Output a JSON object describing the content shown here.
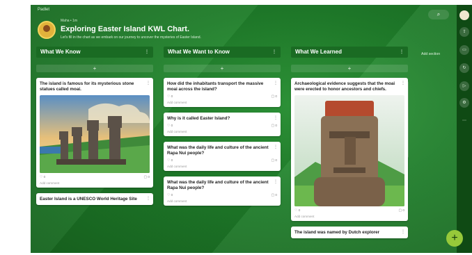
{
  "app": {
    "name": "Padlet"
  },
  "header": {
    "author": "Maha • 1m",
    "title": "Exploring Easter Island KWL Chart.",
    "subtitle": "Let's fill in the chart as we embark on our journey to uncover the mysteries of Easter Island."
  },
  "toolbar": {
    "search_icon": "search-icon",
    "search_glyph": "⌕"
  },
  "add_section_label": "Add section",
  "columns": [
    {
      "title": "What We Know",
      "add_label": "+",
      "cards": [
        {
          "text": "The island is famous for its mysterious stone statues called moai.",
          "likes": "♡ 0",
          "comments": "▢ 0",
          "comment_label": "Add comment",
          "image": "moai-row-image"
        },
        {
          "text": "Easter Island is a UNESCO World Heritage Site",
          "likes": "",
          "comments": "",
          "comment_label": ""
        }
      ]
    },
    {
      "title": "What We Want to Know",
      "add_label": "+",
      "cards": [
        {
          "text": "How did the inhabitants transport the massive moai across the island?",
          "likes": "♡ 0",
          "comments": "▢ 0",
          "comment_label": "Add comment"
        },
        {
          "text": "Why is it called Easter Island?",
          "likes": "♡ 0",
          "comments": "▢ 0",
          "comment_label": "Add comment"
        },
        {
          "text": "What was the daily life and culture of the ancient Rapa Nui people?",
          "likes": "♡ 0",
          "comments": "▢ 0",
          "comment_label": "Add comment"
        },
        {
          "text": "What was the daily life and culture of the ancient Rapa Nui people?",
          "likes": "♡ 0",
          "comments": "▢ 0",
          "comment_label": "Add comment"
        }
      ]
    },
    {
      "title": "What We Learned",
      "add_label": "+",
      "cards": [
        {
          "text": "Archaeological evidence suggests that the moai were erected to honor ancestors and chiefs.",
          "likes": "♡ 0",
          "comments": "▢ 0",
          "comment_label": "Add comment",
          "image": "moai-closeup-image"
        },
        {
          "text": "The island was named by Dutch explorer",
          "likes": "",
          "comments": "",
          "comment_label": ""
        }
      ]
    }
  ],
  "fab_label": "+",
  "rail_icons": [
    "profile-icon",
    "share-icon",
    "slideshow-icon",
    "remake-icon",
    "play-icon",
    "settings-icon",
    "more-icon"
  ],
  "rail_glyphs": [
    "",
    "⇪",
    "▭",
    "↻",
    "▷",
    "⚙",
    "⋯"
  ]
}
